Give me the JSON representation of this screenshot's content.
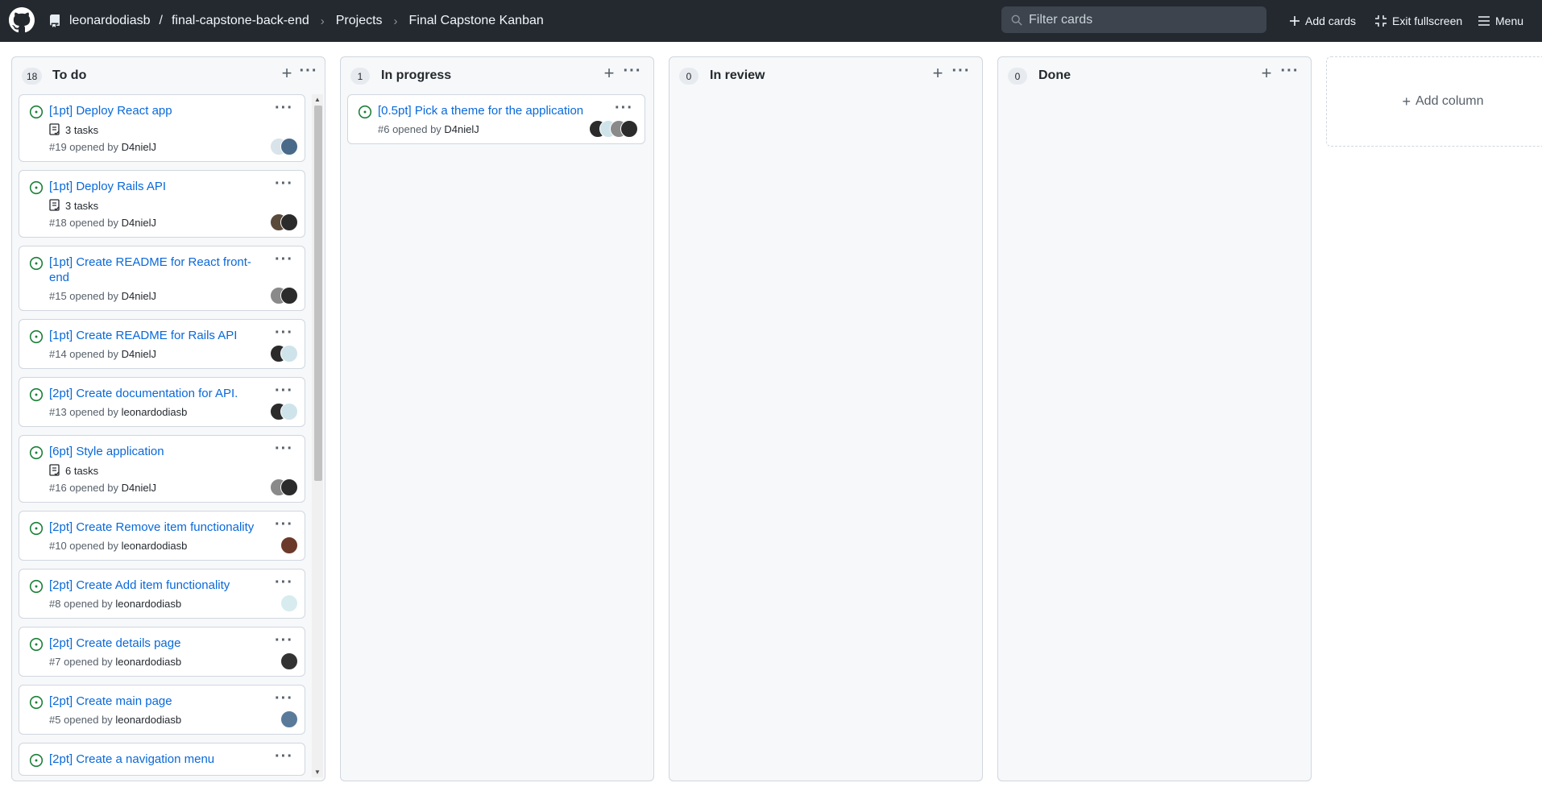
{
  "header": {
    "owner": "leonardodiasb",
    "repo": "final-capstone-back-end",
    "projects": "Projects",
    "project_name": "Final Capstone Kanban",
    "filter_placeholder": "Filter cards",
    "add_cards": "Add cards",
    "exit_fullscreen": "Exit fullscreen",
    "menu": "Menu",
    "icons": [
      "github-logo-icon",
      "repo-icon",
      "search-icon",
      "plus-icon",
      "screen-normal-icon",
      "hamburger-icon"
    ]
  },
  "columns": [
    {
      "title": "To do",
      "count": "18",
      "cards": [
        {
          "title": "[1pt] Deploy React app",
          "tasks": "3 tasks",
          "meta_prefix": "#19 opened by ",
          "user": "D4nielJ",
          "avatars": [
            "#4a6a8a",
            "#d8e4ea"
          ]
        },
        {
          "title": "[1pt] Deploy Rails API",
          "tasks": "3 tasks",
          "meta_prefix": "#18 opened by ",
          "user": "D4nielJ",
          "avatars": [
            "#2b2b2b",
            "#5a4a3a"
          ]
        },
        {
          "title": "[1pt] Create README for React front-end",
          "tasks": "",
          "meta_prefix": "#15 opened by ",
          "user": "D4nielJ",
          "avatars": [
            "#2b2b2b",
            "#8a8a8a"
          ]
        },
        {
          "title": "[1pt] Create README for Rails API",
          "tasks": "",
          "meta_prefix": "#14 opened by ",
          "user": "D4nielJ",
          "avatars": [
            "#cfe3ea",
            "#2b2b2b"
          ]
        },
        {
          "title": "[2pt] Create documentation for API.",
          "tasks": "",
          "meta_prefix": "#13 opened by ",
          "user": "leonardodiasb",
          "avatars": [
            "#cfe3ea",
            "#2b2b2b"
          ]
        },
        {
          "title": "[6pt] Style application",
          "tasks": "6 tasks",
          "meta_prefix": "#16 opened by ",
          "user": "D4nielJ",
          "avatars": [
            "#2b2b2b",
            "#8a8a8a"
          ]
        },
        {
          "title": "[2pt] Create Remove item functionality",
          "tasks": "",
          "meta_prefix": "#10 opened by ",
          "user": "leonardodiasb",
          "avatars": [
            "#6b3a2a"
          ]
        },
        {
          "title": "[2pt] Create Add item functionality",
          "tasks": "",
          "meta_prefix": "#8 opened by ",
          "user": "leonardodiasb",
          "avatars": [
            "#d8ecef"
          ]
        },
        {
          "title": "[2pt] Create details page",
          "tasks": "",
          "meta_prefix": "#7 opened by ",
          "user": "leonardodiasb",
          "avatars": [
            "#333333"
          ]
        },
        {
          "title": "[2pt] Create main page",
          "tasks": "",
          "meta_prefix": "#5 opened by ",
          "user": "leonardodiasb",
          "avatars": [
            "#5a7a9a"
          ]
        },
        {
          "title": "[2pt] Create a navigation menu",
          "tasks": "",
          "meta_prefix": "",
          "user": "",
          "avatars": []
        }
      ]
    },
    {
      "title": "In progress",
      "count": "1",
      "cards": [
        {
          "title": "[0.5pt] Pick a theme for the application",
          "tasks": "",
          "meta_prefix": "#6 opened by ",
          "user": "D4nielJ",
          "avatars": [
            "#2b2b2b",
            "#8a8a8a",
            "#cfe3ea",
            "#2b2b2b"
          ]
        }
      ]
    },
    {
      "title": "In review",
      "count": "0",
      "cards": []
    },
    {
      "title": "Done",
      "count": "0",
      "cards": []
    }
  ],
  "add_column": "Add column",
  "colors": {
    "header_bg": "#24292f",
    "link": "#0969da",
    "open_issue": "#1a7f37"
  }
}
